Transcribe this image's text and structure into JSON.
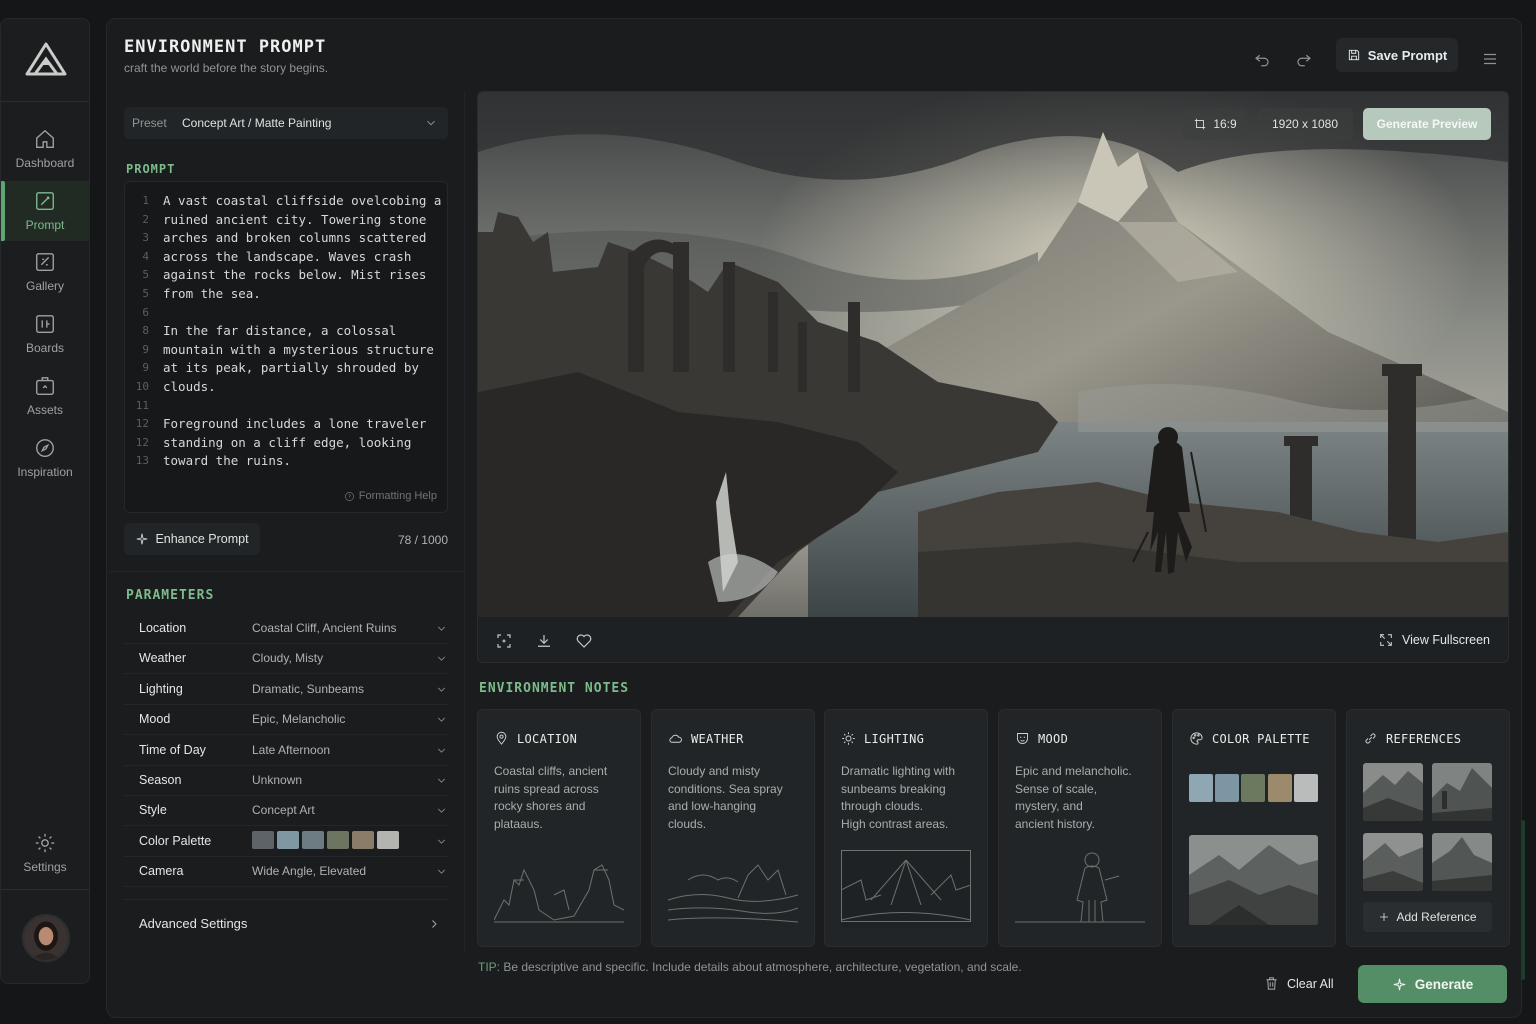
{
  "sidebar": {
    "logo": "mountain-logo",
    "items": [
      {
        "label": "Dashboard",
        "icon": "home-icon"
      },
      {
        "label": "Prompt",
        "icon": "edit-icon",
        "active": true
      },
      {
        "label": "Gallery",
        "icon": "image-icon"
      },
      {
        "label": "Boards",
        "icon": "board-icon"
      },
      {
        "label": "Assets",
        "icon": "box-icon"
      },
      {
        "label": "Inspiration",
        "icon": "compass-icon"
      }
    ],
    "settings": {
      "label": "Settings",
      "icon": "gear-icon"
    }
  },
  "header": {
    "title": "ENVIRONMENT PROMPT",
    "subtitle": "craft the world before the story begins.",
    "save_label": "Save Prompt"
  },
  "preset": {
    "label": "Preset",
    "value": "Concept Art / Matte Painting"
  },
  "prompt": {
    "heading": "PROMPT",
    "lines": [
      {
        "n": "1",
        "t": "A vast coastal cliffside ovelcobing a"
      },
      {
        "n": "2",
        "t": "ruined ancient city. Towering stone"
      },
      {
        "n": "3",
        "t": "arches and broken columns scattered"
      },
      {
        "n": "4",
        "t": "across the landscape. Waves crash"
      },
      {
        "n": "5",
        "t": "against the rocks below. Mist rises"
      },
      {
        "n": "5",
        "t": "from the sea."
      },
      {
        "n": "6",
        "t": ""
      },
      {
        "n": "8",
        "t": "In the far distance, a colossal"
      },
      {
        "n": "9",
        "t": "mountain with a mysterious structure"
      },
      {
        "n": "9",
        "t": "at its peak, partially shrouded by"
      },
      {
        "n": "10",
        "t": "clouds."
      },
      {
        "n": "11",
        "t": ""
      },
      {
        "n": "12",
        "t": "Foreground includes a lone traveler"
      },
      {
        "n": "12",
        "t": "standing on a cliff edge, looking"
      },
      {
        "n": "13",
        "t": "toward the ruins."
      }
    ],
    "formatting_help": "Formatting Help",
    "enhance_label": "Enhance Prompt",
    "char_count": "78 / 1000"
  },
  "parameters": {
    "heading": "PARAMETERS",
    "rows": [
      {
        "key": "Location",
        "value": "Coastal Cliff, Ancient Ruins"
      },
      {
        "key": "Weather",
        "value": "Cloudy, Misty"
      },
      {
        "key": "Lighting",
        "value": "Dramatic, Sunbeams"
      },
      {
        "key": "Mood",
        "value": "Epic, Melancholic"
      },
      {
        "key": "Time of Day",
        "value": "Late Afternoon"
      },
      {
        "key": "Season",
        "value": "Unknown"
      },
      {
        "key": "Style",
        "value": "Concept Art"
      },
      {
        "key": "Color Palette",
        "value": ""
      },
      {
        "key": "Camera",
        "value": "Wide Angle, Elevated"
      }
    ],
    "palette": [
      "#5d6366",
      "#7f97a3",
      "#6c7c82",
      "#6b7560",
      "#8a7c68",
      "#b3b3b0"
    ],
    "advanced_label": "Advanced Settings"
  },
  "preview": {
    "aspect": "16:9",
    "resolution": "1920 x 1080",
    "generate_preview_label": "Generate Preview",
    "fullscreen_label": "View Fullscreen"
  },
  "notes": {
    "heading": "ENVIRONMENT NOTES",
    "cards": [
      {
        "title": "LOCATION",
        "icon": "pin-icon",
        "body": "Coastal cliffs, ancient\nruins spread across\nrocky shores and\nplataaus."
      },
      {
        "title": "WEATHER",
        "icon": "cloud-icon",
        "body": "Cloudy and misty\nconditions. Sea spray\nand low-hanging\nclouds."
      },
      {
        "title": "LIGHTING",
        "icon": "sun-icon",
        "body": "Dramatic lighting with\nsunbeams breaking\nthrough clouds.\nHigh contrast areas."
      },
      {
        "title": "MOOD",
        "icon": "mask-icon",
        "body": "Epic and melancholic.\nSense of scale,\nmystery, and\nancient history."
      },
      {
        "title": "COLOR PALETTE",
        "icon": "palette-icon",
        "body": ""
      },
      {
        "title": "REFERENCES",
        "icon": "link-icon",
        "body": ""
      }
    ],
    "note_palette": [
      "#8fa7b3",
      "#7d96a3",
      "#6b7a5e",
      "#9c8a6c",
      "#b9bcbb"
    ],
    "add_reference_label": "Add Reference"
  },
  "footer": {
    "tip_prefix": "TIP:",
    "tip": " Be descriptive and specific. Include details about atmosphere, architecture, vegetation, and scale.",
    "clear_label": "Clear All",
    "generate_label": "Generate"
  },
  "colors": {
    "accent": "#5fa573",
    "generate_bg": "#548e66",
    "heading": "#7dbb8c"
  }
}
